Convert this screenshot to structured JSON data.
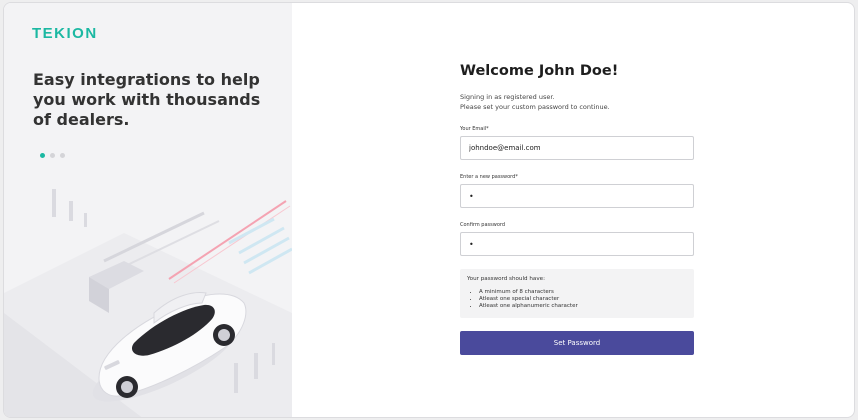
{
  "brand": {
    "logo_text": "TEKION",
    "accent_color": "#1bb8a2"
  },
  "hero": {
    "tagline": "Easy integrations to help you work with thousands of dealers.",
    "carousel": {
      "slide_count": 3,
      "active_index": 0
    }
  },
  "form": {
    "title": "Welcome John Doe!",
    "subtitle_line1": "Signing in as registered user.",
    "subtitle_line2": "Please set your custom password to continue.",
    "email": {
      "label": "Your Email*",
      "value": "johndoe@email.com"
    },
    "new_password": {
      "label": "Enter a new password*",
      "value": "•"
    },
    "confirm_password": {
      "label": "Confirm password",
      "value": "•"
    },
    "requirements": {
      "title": "Your password should have:",
      "items": [
        "A minimum of 8 characters",
        "Atleast one special character",
        "Atleast one alphanumeric character"
      ]
    },
    "submit_label": "Set Password",
    "submit_color": "#4a4a9c"
  },
  "icons": [
    "car-illustration-icon",
    "carousel-dot-icon"
  ]
}
